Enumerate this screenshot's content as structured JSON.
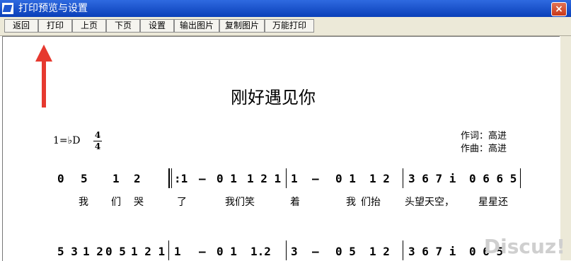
{
  "window": {
    "title": "打印预览与设置",
    "close_label": "×"
  },
  "toolbar": {
    "buttons": [
      "返回",
      "打印",
      "上页",
      "下页",
      "设置",
      "输出图片",
      "复制图片",
      "万能打印"
    ]
  },
  "score": {
    "title": "刚好遇见你",
    "key": "1=♭D",
    "time_numerator": "4",
    "time_denominator": "4",
    "lyricist": "作词：高进",
    "composer": "作曲：高进"
  },
  "line1": {
    "notes": [
      "0",
      "5",
      "1",
      "2",
      ":1",
      "–",
      "0 1",
      "1 2 1",
      "1",
      "–",
      "0 1",
      "1 2",
      "3 6 7 i",
      "0 6 6 5"
    ],
    "lyrics": [
      "我",
      "们",
      "哭",
      "了",
      "我们笑",
      "着",
      "我",
      "们抬",
      "头望天空，",
      "星星还"
    ]
  },
  "line2": {
    "notes": [
      "5 3",
      "1 2",
      "0 5",
      "1 2 1",
      "1",
      "–",
      "0 1",
      "1.2",
      "3",
      "–",
      "0 5",
      "1 2",
      "3 6 7 i",
      "0 6 5"
    ]
  },
  "watermark": "Discuz!",
  "colors": {
    "titlebar": "#2f6ae0",
    "toolbar": "#ece9d8",
    "arrow": "#e6392f"
  }
}
